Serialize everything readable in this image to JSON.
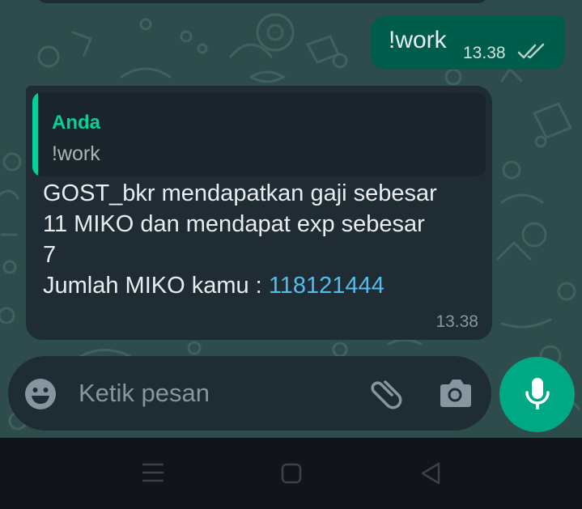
{
  "outgoing_message": {
    "text": "!work",
    "time": "13.38",
    "status_icon": "double-check-icon"
  },
  "incoming_message": {
    "quote": {
      "sender": "Anda",
      "text": "!work"
    },
    "lines": [
      "GOST_bkr mendapatkan gaji sebesar",
      "11 MIKO dan mendapat exp sebesar",
      "7"
    ],
    "balance_label": "Jumlah MIKO kamu : ",
    "balance_value": "118121444",
    "time": "13.38"
  },
  "composer": {
    "placeholder": "Ketik pesan",
    "icons": [
      "emoji-icon",
      "paperclip-icon",
      "camera-icon",
      "microphone-icon"
    ]
  },
  "navigation": {
    "icons": [
      "menu-icon",
      "home-icon",
      "back-icon"
    ]
  },
  "colors": {
    "wallpaper": "#2e4c4b",
    "outgoing_bubble": "#005c4b",
    "incoming_bubble": "#1f2c33",
    "accent": "#00a884",
    "quote_name": "#06cf9c",
    "link": "#53bdeb"
  }
}
